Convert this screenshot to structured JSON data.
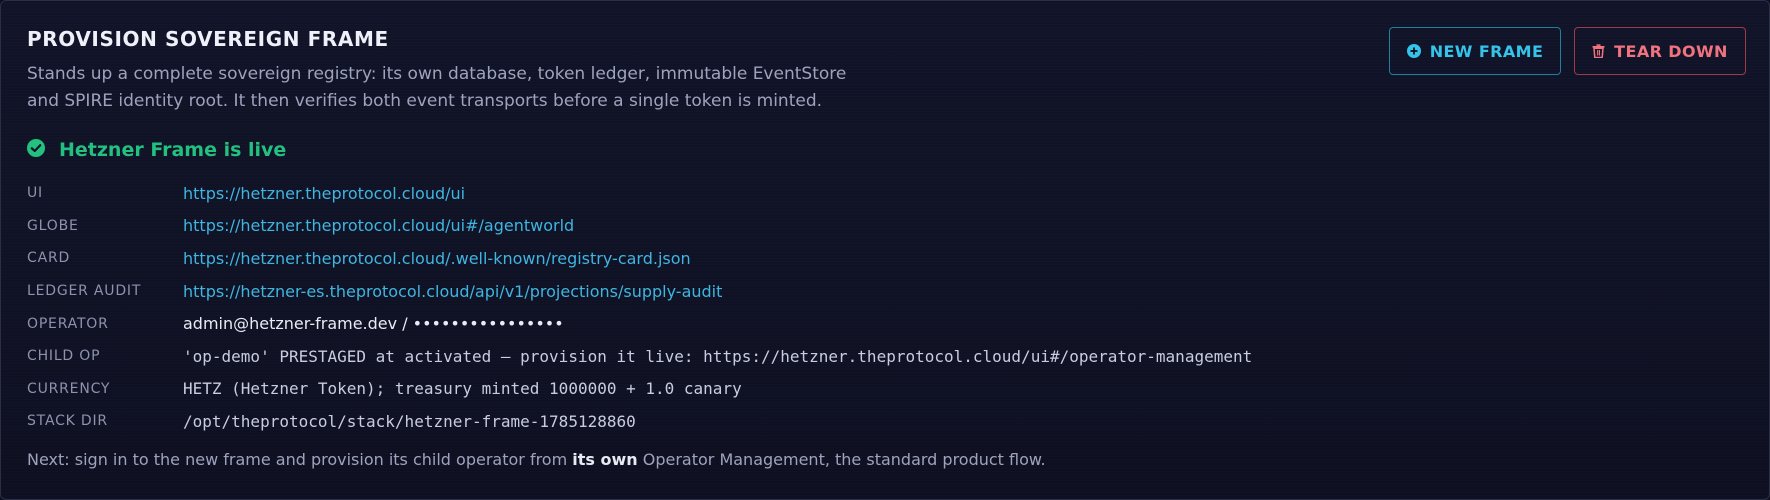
{
  "header": {
    "title": "PROVISION SOVEREIGN FRAME",
    "description": "Stands up a complete sovereign registry: its own database, token ledger, immutable EventStore and SPIRE identity root. It then verifies both event transports before a single token is minted."
  },
  "actions": {
    "new_frame": {
      "label": "NEW FRAME",
      "icon": "plus-circle-icon",
      "color": "#35c3ea"
    },
    "tear_down": {
      "label": "TEAR DOWN",
      "icon": "trash-icon",
      "color": "#f0737f"
    }
  },
  "status": {
    "icon": "check-circle-icon",
    "text": "Hetzner Frame is live",
    "color": "#23c180"
  },
  "details": [
    {
      "key": "UI",
      "value": "https://hetzner.theprotocol.cloud/ui",
      "kind": "link"
    },
    {
      "key": "GLOBE",
      "value": "https://hetzner.theprotocol.cloud/ui#/agentworld",
      "kind": "link"
    },
    {
      "key": "CARD",
      "value": "https://hetzner.theprotocol.cloud/.well-known/registry-card.json",
      "kind": "link"
    },
    {
      "key": "LEDGER AUDIT",
      "value": "https://hetzner-es.theprotocol.cloud/api/v1/projections/supply-audit",
      "kind": "link"
    },
    {
      "key": "OPERATOR",
      "value": "admin@hetzner-frame.dev / ••••••••••••••••",
      "kind": "text"
    },
    {
      "key": "CHILD OP",
      "value": "'op-demo' PRESTAGED at activated — provision it live: https://hetzner.theprotocol.cloud/ui#/operator-management",
      "kind": "mono"
    },
    {
      "key": "CURRENCY",
      "value": "HETZ (Hetzner Token); treasury minted 1000000 + 1.0 canary",
      "kind": "mono"
    },
    {
      "key": "STACK DIR",
      "value": "/opt/theprotocol/stack/hetzner-frame-1785128860",
      "kind": "mono"
    }
  ],
  "footer": {
    "prefix": "Next: sign in to the new frame and provision its child operator from ",
    "emphasis": "its own",
    "suffix": " Operator Management, the standard product flow."
  }
}
